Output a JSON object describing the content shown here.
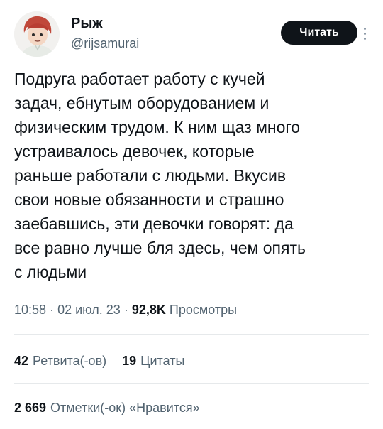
{
  "author": {
    "name": "Рыж",
    "handle": "@rijsamurai",
    "avatar_icon": "avatar-illustration"
  },
  "actions": {
    "follow_label": "Читать",
    "more_icon": "more-vertical-icon"
  },
  "tweet": {
    "lines": [
      "Подруга работает работу с кучей",
      "задач, ебнутым оборудованием и",
      "физическим трудом. К ним щаз много",
      "устраивалось девочек, которые",
      "раньше работали с людьми. Вкусив",
      "свои новые обязанности и страшно",
      "заебавшись, эти девочки говорят: да",
      "все равно лучше бля здесь, чем опять",
      "с людьми"
    ]
  },
  "meta": {
    "time": "10:58",
    "separator": "·",
    "date": "02 июл. 23",
    "views_count": "92,8K",
    "views_label": "Просмотры"
  },
  "stats": {
    "retweets_count": "42",
    "retweets_label": "Ретвита(-ов)",
    "quotes_count": "19",
    "quotes_label": "Цитаты",
    "likes_count": "2 669",
    "likes_label": "Отметки(-ок) «Нравится»"
  },
  "colors": {
    "text": "#0f1419",
    "secondary": "#536471",
    "button_bg": "#0f1419",
    "divider": "#e6e9eb"
  }
}
